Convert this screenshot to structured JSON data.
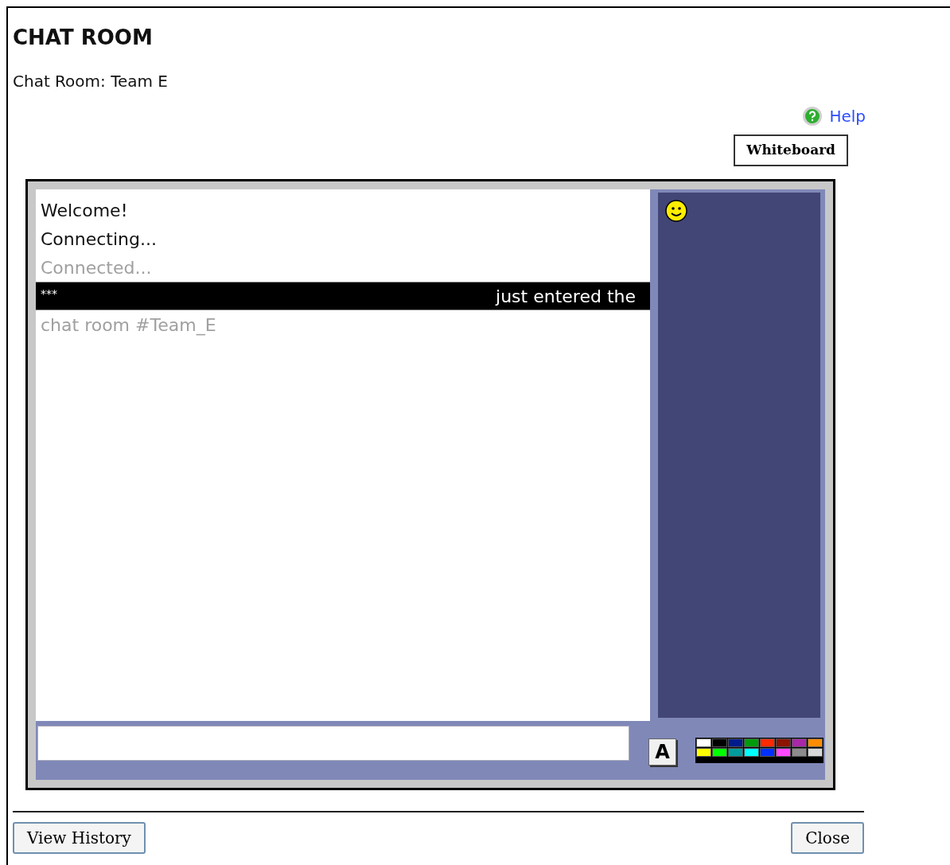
{
  "page": {
    "title": "CHAT ROOM",
    "subtitle": "Chat Room: Team E"
  },
  "help_link": "Help",
  "whiteboard_button": "Whiteboard",
  "messages": [
    {
      "kind": "normal",
      "text": "Welcome!"
    },
    {
      "kind": "normal",
      "text": "Connecting..."
    },
    {
      "kind": "muted",
      "text": "Connected..."
    },
    {
      "kind": "banner",
      "left": "***",
      "right": "just entered the"
    },
    {
      "kind": "muted",
      "text": "chat room #Team_E"
    }
  ],
  "font_button": "A",
  "palette": [
    {
      "color": "#ffffff"
    },
    {
      "color": "#000000"
    },
    {
      "color": "#001c8c"
    },
    {
      "color": "#009c0c"
    },
    {
      "color": "#ff2a00"
    },
    {
      "color": "#8c1400"
    },
    {
      "color": "#a828a8"
    },
    {
      "color": "#ff8c00"
    },
    {
      "color": "#ffff00"
    },
    {
      "color": "#00ff00"
    },
    {
      "color": "#009c9c"
    },
    {
      "color": "#00ffff"
    },
    {
      "color": "#0030ff"
    },
    {
      "color": "#ff48ff"
    },
    {
      "color": "#8c8c8c"
    },
    {
      "color": "#d8d8d8"
    }
  ],
  "footer": {
    "view_history": "View History",
    "close": "Close"
  }
}
